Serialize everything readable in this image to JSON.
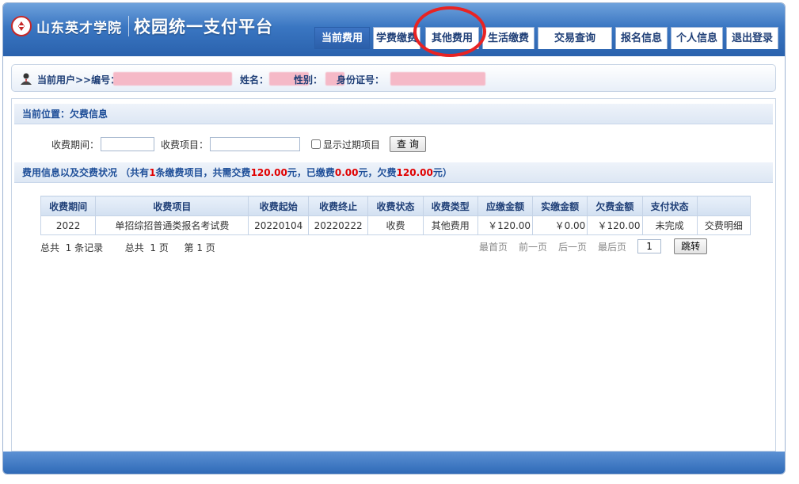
{
  "header": {
    "school_name": "山东英才学院",
    "platform_title": "校园统一支付平台"
  },
  "nav": {
    "tabs": [
      {
        "label": "当前费用",
        "active": true
      },
      {
        "label": "学费缴费"
      },
      {
        "label": "其他费用",
        "circled": true
      },
      {
        "label": "生活缴费"
      },
      {
        "label": "交易查询"
      },
      {
        "label": "报名信息"
      },
      {
        "label": "个人信息"
      },
      {
        "label": "退出登录"
      }
    ]
  },
  "userbar": {
    "prefix": "当前用户>>编号：",
    "name_label": "姓名：",
    "gender_label": "性别：",
    "id_label": "身份证号："
  },
  "location": {
    "text": "当前位置：欠费信息"
  },
  "search": {
    "period_label": "收费期间：",
    "period_value": "",
    "item_label": "收费项目：",
    "item_value": "",
    "show_expired_label": "显示过期项目",
    "show_expired_checked": false,
    "query_button": "查 询"
  },
  "summary": {
    "prefix": "费用信息以及交费状况 （共有",
    "count": "1",
    "mid1": "条缴费项目，共需交费",
    "total_due": "120.00",
    "mid2": "元，已缴费",
    "paid": "0.00",
    "mid3": "元，欠费",
    "owed": "120.00",
    "suffix": "元）"
  },
  "table": {
    "headers": [
      "收费期间",
      "收费项目",
      "收费起始",
      "收费终止",
      "收费状态",
      "收费类型",
      "应缴金额",
      "实缴金额",
      "欠费金额",
      "支付状态",
      ""
    ],
    "rows": [
      {
        "period": "2022",
        "item": "单招综招普通类报名考试费",
        "start": "20220104",
        "end": "20220222",
        "status": "收费",
        "type": "其他费用",
        "due": "￥120.00",
        "paid": "￥0.00",
        "owed": "￥120.00",
        "pay_status": "未完成",
        "action": "交费明细"
      }
    ]
  },
  "pager": {
    "total_records": "总共  1 条记录",
    "total_pages": "总共  1 页",
    "current_page": "第 1 页",
    "first": "最首页",
    "prev": "前一页",
    "next": "后一页",
    "last": "最后页",
    "page_value": "1",
    "jump": "跳转"
  },
  "colors": {
    "header_blue": "#3a76c2",
    "accent_red": "#e00000",
    "circle_red": "#e82323",
    "text_blue": "#1f3f77"
  }
}
